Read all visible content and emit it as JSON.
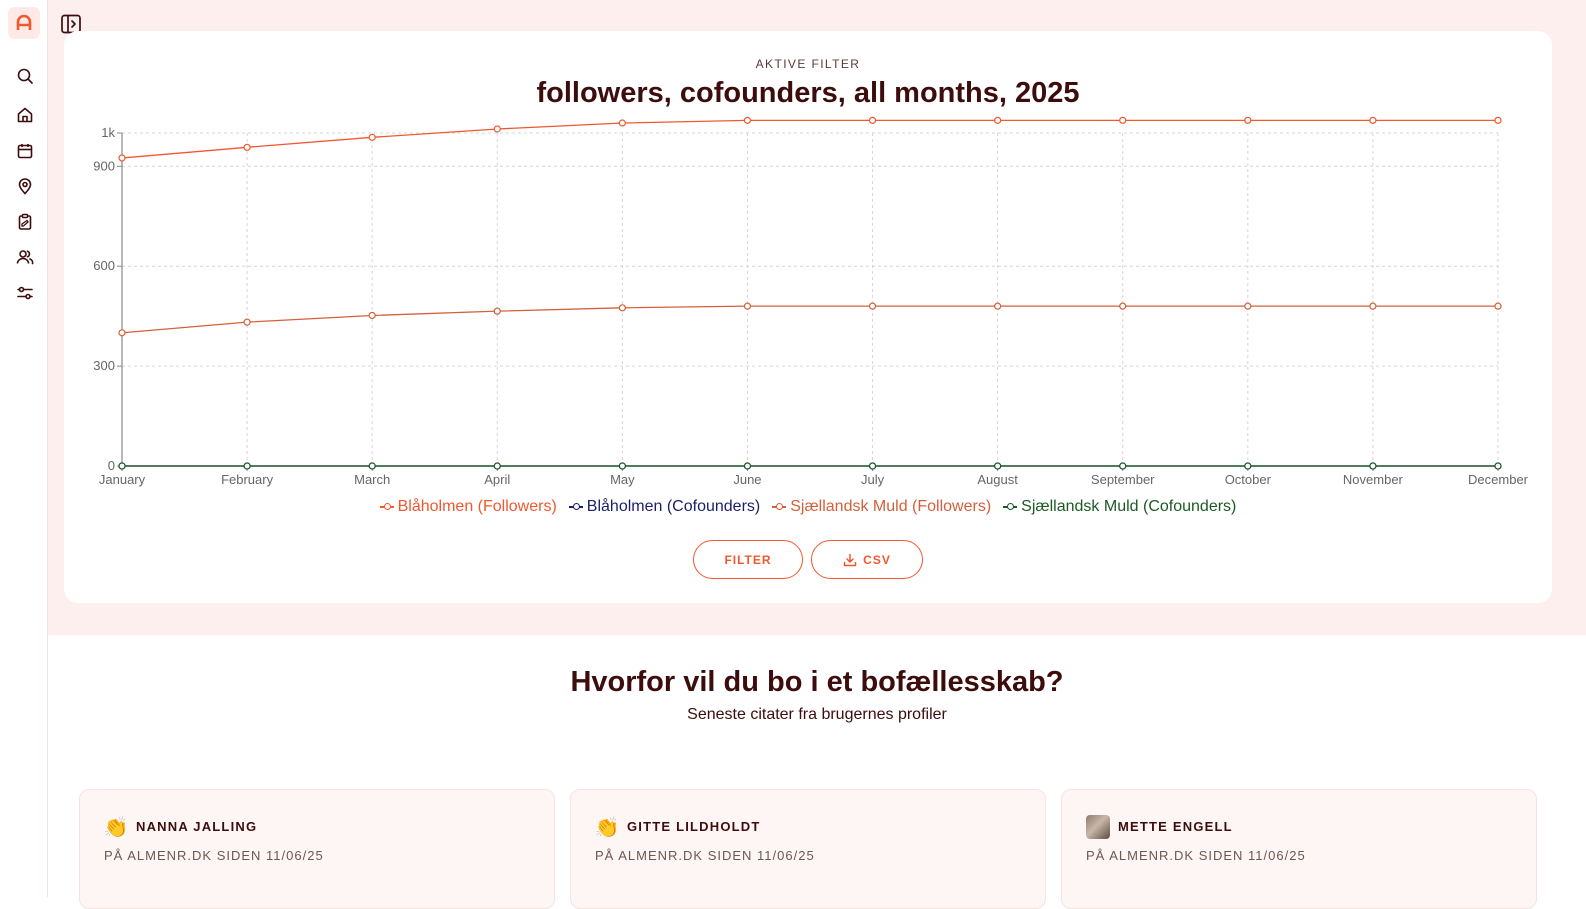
{
  "app": {
    "logo_letter": "A"
  },
  "sidebar": {
    "items": [
      {
        "name": "search",
        "icon": "search-icon"
      },
      {
        "name": "home",
        "icon": "home-icon"
      },
      {
        "name": "calendar",
        "icon": "calendar-icon"
      },
      {
        "name": "location",
        "icon": "map-pin-icon"
      },
      {
        "name": "clipboard",
        "icon": "clipboard-icon"
      },
      {
        "name": "users",
        "icon": "users-icon"
      },
      {
        "name": "settings",
        "icon": "sliders-icon"
      }
    ]
  },
  "filter_card": {
    "eyebrow": "AKTIVE FILTER",
    "title": "followers, cofounders, all months, 2025",
    "filter_button": "FILTER",
    "csv_button": "CSV"
  },
  "colors": {
    "accent": "#f0582e",
    "brand_dark": "#3d0d0d",
    "series_blaholmen_followers": "#f0582e",
    "series_blaholmen_cofounders": "#1a1f6b",
    "series_sjaellandsk_followers": "#d3603a",
    "series_sjaellandsk_cofounders": "#1c5a25"
  },
  "chart_data": {
    "type": "line",
    "categories": [
      "January",
      "February",
      "March",
      "April",
      "May",
      "June",
      "July",
      "August",
      "September",
      "October",
      "November",
      "December"
    ],
    "ylim": [
      0,
      1000
    ],
    "yticks": [
      0,
      300,
      600,
      900,
      1000
    ],
    "ytick_labels": [
      "0",
      "300",
      "600",
      "900",
      "1k"
    ],
    "grid": true,
    "legend_placement": "bottom",
    "series": [
      {
        "name": "Blåholmen (Followers)",
        "color": "#f0582e",
        "values": [
          925,
          957,
          987,
          1012,
          1030,
          1038,
          1038,
          1038,
          1038,
          1038,
          1038,
          1038
        ]
      },
      {
        "name": "Blåholmen (Cofounders)",
        "color": "#1a1f6b",
        "values": [
          0,
          0,
          0,
          0,
          0,
          0,
          0,
          0,
          0,
          0,
          0,
          0
        ]
      },
      {
        "name": "Sjællandsk Muld (Followers)",
        "color": "#d3603a",
        "values": [
          400,
          432,
          452,
          465,
          475,
          480,
          480,
          480,
          480,
          480,
          480,
          480
        ]
      },
      {
        "name": "Sjællandsk Muld (Cofounders)",
        "color": "#1c5a25",
        "values": [
          0,
          0,
          0,
          0,
          0,
          0,
          0,
          0,
          0,
          0,
          0,
          0
        ]
      }
    ]
  },
  "quotes_section": {
    "title": "Hvorfor vil du bo i et bofællesskab?",
    "subtitle": "Seneste citater fra brugernes profiler",
    "cards": [
      {
        "name": "NANNA JALLING",
        "meta": "PÅ ALMENR.DK SIDEN 11/06/25",
        "avatar": "clapping-hands-emoji"
      },
      {
        "name": "GITTE LILDHOLDT",
        "meta": "PÅ ALMENR.DK SIDEN 11/06/25",
        "avatar": "clapping-hands-emoji"
      },
      {
        "name": "METTE ENGELL",
        "meta": "PÅ ALMENR.DK SIDEN 11/06/25",
        "avatar": "photo-avatar"
      }
    ]
  }
}
